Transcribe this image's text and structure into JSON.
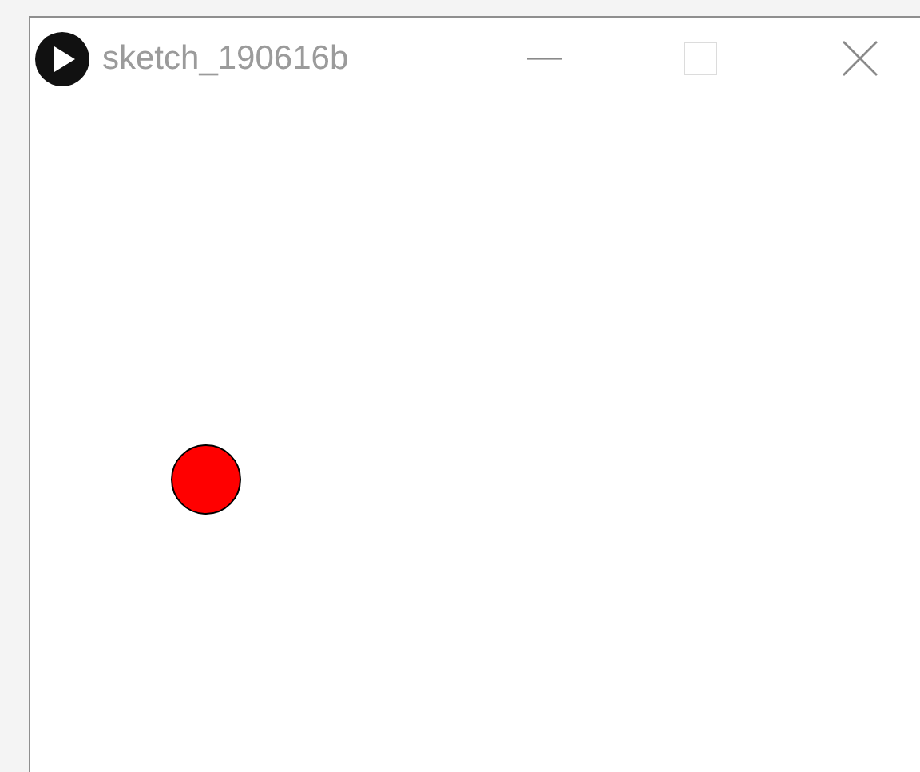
{
  "window": {
    "title": "sketch_190616b"
  },
  "title_buttons": [
    {
      "kind": "minimize",
      "disabled": false
    },
    {
      "kind": "maximize",
      "disabled": true
    },
    {
      "kind": "close",
      "disabled": false
    }
  ],
  "canvas": {
    "shapes": [
      {
        "kind": "circle"
      }
    ]
  }
}
